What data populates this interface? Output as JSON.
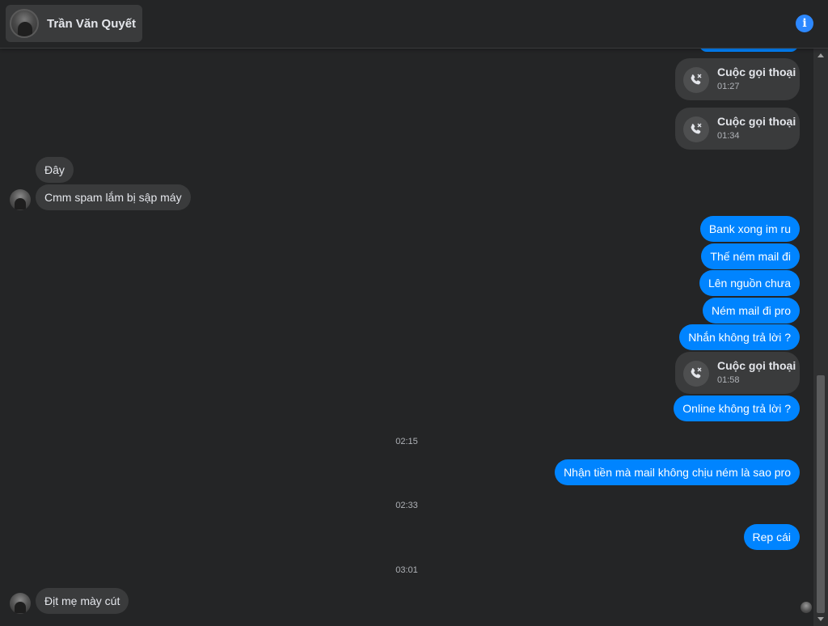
{
  "header": {
    "contact_name": "Trần Văn Quyết",
    "info_icon": "info-icon",
    "info_symbol": "i",
    "accent_color": "#0084ff"
  },
  "messages": {
    "call_1": {
      "title": "Cuộc gọi thoại",
      "time": "01:27"
    },
    "call_2": {
      "title": "Cuộc gọi thoại",
      "time": "01:34"
    },
    "in_1": "Đây",
    "in_2": "Cmm spam lắm bị sập máy",
    "out_1": "Bank xong im ru",
    "out_2": "Thế ném mail đi",
    "out_3": "Lên nguồn chưa",
    "out_4": "Ném mail đi pro",
    "out_5": "Nhắn không trả lời ?",
    "call_3": {
      "title": "Cuộc gọi thoại",
      "time": "01:58"
    },
    "out_6": "Online không trả lời ?",
    "ts_1": "02:15",
    "out_7": "Nhận tiền mà mail không chịu ném là sao pro",
    "ts_2": "02:33",
    "out_8": "Rep cái",
    "ts_3": "03:01",
    "in_3": "Địt mẹ mày cút"
  },
  "icons": {
    "call": "missed-call-icon",
    "avatar": "avatar"
  }
}
